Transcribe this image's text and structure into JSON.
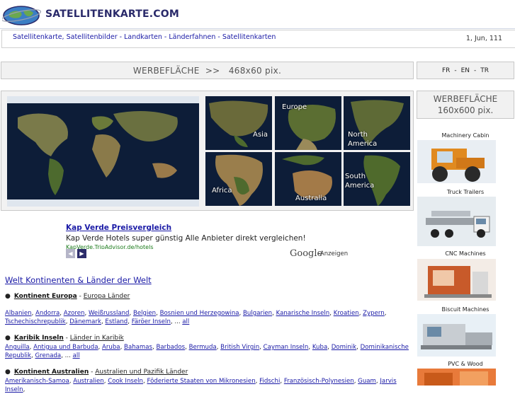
{
  "header": {
    "logo_text": "SATELLITENKARTE.COM",
    "nav_links": "Satellitenkarte, Satellitenbilder - Landkarten - Länderfahnen - Satellitenkarten",
    "date": "1, Jun, 111"
  },
  "banners": {
    "main": "WERBEFLÄCHE  >>   468x60 pix.",
    "side_line1": "WERBEFLÄCHE",
    "side_line2": "160x600 pix."
  },
  "languages": [
    "FR",
    "-",
    "EN",
    "-",
    "TR"
  ],
  "map_tiles": {
    "asia": "Asia",
    "europe": "Europe",
    "north_america_1": "North",
    "north_america_2": "America",
    "africa": "Africa",
    "australia": "Australia",
    "south_america_1": "South",
    "south_america_2": "America"
  },
  "side_ads": [
    {
      "title": "Machinery Cabin"
    },
    {
      "title": "Truck Trailers"
    },
    {
      "title": "CNC Machines"
    },
    {
      "title": "Biscuit Machines"
    },
    {
      "title": "PVC & Wood"
    }
  ],
  "ad": {
    "title": "Kap Verde Preisvergleich",
    "text": "Kap Verde Hotels super günstig Alle Anbieter direkt vergleichen!",
    "url": "KapVerde.TripAdvisor.de/hotels",
    "prev": "◀",
    "next": "▶",
    "google": "Google",
    "google_label": "-Anzeigen"
  },
  "welt_title": "Welt Kontinenten & Länder der Welt",
  "continents": [
    {
      "name": "Kontinent Europa",
      "sep": " - ",
      "sub": "Europa Länder",
      "countries": [
        "Albanien",
        "Andorra",
        "Azoren",
        "Weißrussland",
        "Belgien",
        "Bosnien und Herzegowina",
        "Bulgarien",
        "Kanarische Inseln",
        "Kroatien",
        "Zypern",
        "Tschechischrepublik",
        "Dänemark",
        "Estland",
        "Färöer Inseln"
      ],
      "more": "all"
    },
    {
      "name": "Karibik Inseln",
      "sep": " - ",
      "sub": "Länder in Karibik",
      "countries": [
        "Anguilla",
        "Antigua und Barbuda",
        "Aruba",
        "Bahamas",
        "Barbados",
        "Bermuda",
        "British Virgin",
        "Cayman Inseln",
        "Kuba",
        "Dominik",
        "Dominikanische Republik",
        "Grenada"
      ],
      "more": "all"
    },
    {
      "name": "Kontinent Australien",
      "sep": " - ",
      "sub": "Australien und Pazifik Länder",
      "countries": [
        "Amerikanisch-Samoa",
        "Australien",
        "Cook Inseln",
        "Föderierte Staaten von Mikronesien",
        "Fidschi",
        "Französisch-Polynesien",
        "Guam",
        "Jarvis Inseln"
      ],
      "more": ""
    }
  ],
  "colors": {
    "link": "#1a1aa6",
    "banner_bg": "#f1f1f1",
    "ocean": "#0d1d38",
    "land": "#5b6a36"
  }
}
